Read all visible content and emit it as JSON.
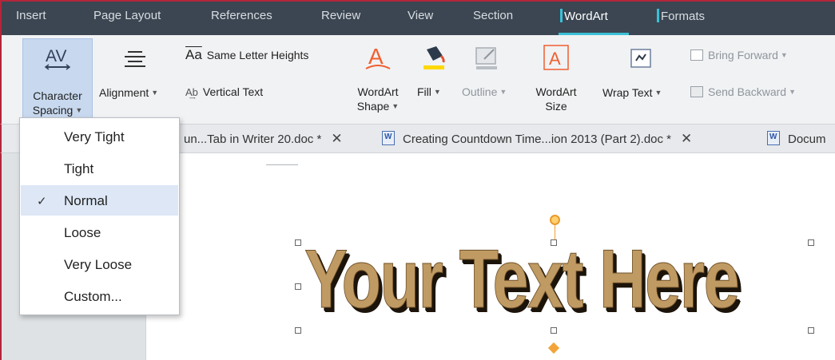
{
  "menubar": {
    "tabs": [
      {
        "label": "Insert"
      },
      {
        "label": "Page Layout"
      },
      {
        "label": "References"
      },
      {
        "label": "Review"
      },
      {
        "label": "View"
      },
      {
        "label": "Section"
      },
      {
        "label": "WordArt",
        "active": true
      },
      {
        "label": "Formats"
      }
    ],
    "accent_colors": {
      "wordart": "#39c1d8",
      "formats": "#39c1d8"
    }
  },
  "ribbon": {
    "character_spacing": {
      "line1": "Character",
      "line2": "Spacing",
      "icon": "character-spacing-icon"
    },
    "alignment": {
      "label": "Alignment",
      "icon": "alignment-icon"
    },
    "same_letter_heights": {
      "label": "Same Letter Heights",
      "icon": "same-letter-heights-icon"
    },
    "vertical_text": {
      "label": "Vertical Text",
      "icon": "vertical-text-icon"
    },
    "wordart_shape": {
      "line1": "WordArt",
      "line2": "Shape",
      "icon": "wordart-shape-icon"
    },
    "fill": {
      "label": "Fill",
      "icon": "fill-bucket-icon"
    },
    "outline": {
      "label": "Outline",
      "icon": "outline-icon"
    },
    "wordart_size": {
      "line1": "WordArt",
      "line2": "Size",
      "icon": "wordart-size-icon"
    },
    "wrap_text": {
      "label": "Wrap Text",
      "icon": "wrap-text-icon"
    },
    "bring_forward": {
      "label": "Bring Forward",
      "icon": "bring-forward-icon"
    },
    "send_backward": {
      "label": "Send Backward",
      "icon": "send-backward-icon"
    }
  },
  "doc_tabs": [
    {
      "title": "un...Tab in Writer 20.doc *",
      "close": "✕"
    },
    {
      "title": "Creating Countdown Time...ion 2013 (Part 2).doc *",
      "close": "✕"
    },
    {
      "title": "Docum"
    }
  ],
  "dropdown": {
    "items": [
      {
        "label": "Very Tight"
      },
      {
        "label": "Tight"
      },
      {
        "label": "Normal",
        "selected": true
      },
      {
        "label": "Loose"
      },
      {
        "label": "Very Loose"
      },
      {
        "label": "Custom..."
      }
    ],
    "check_glyph": "✓"
  },
  "document": {
    "wordart_text": "Your Text Here"
  }
}
